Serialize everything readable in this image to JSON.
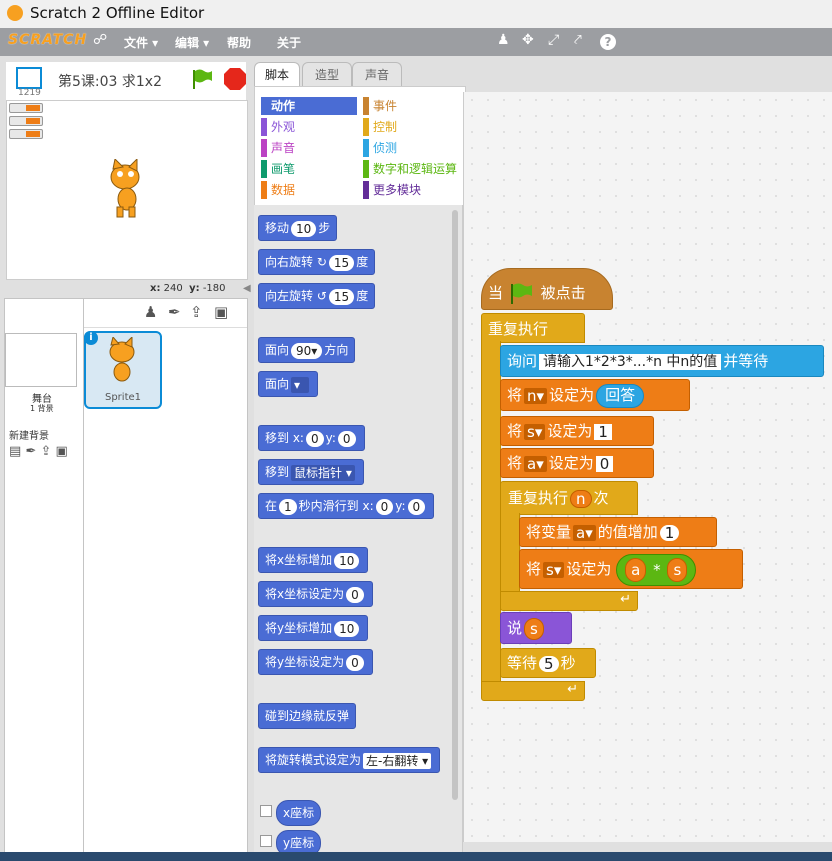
{
  "window": {
    "title": "Scratch 2 Offline Editor"
  },
  "menu": {
    "logo": "SCRATCH",
    "items": [
      "文件 ▾",
      "编辑 ▾",
      "帮助",
      "关于"
    ],
    "toolbar_icons": [
      "duplicate-icon",
      "delete-icon",
      "grow-icon",
      "shrink-icon",
      "help-icon"
    ]
  },
  "stage": {
    "project_title": "第5课:03 求1x2",
    "version": "1219",
    "mouse_x_label": "x:",
    "mouse_x": "240",
    "mouse_y_label": "y:",
    "mouse_y": "-180"
  },
  "sprites": {
    "stage_label": "舞台",
    "backdrops_count": "1 背景",
    "new_backdrop": "新建背景",
    "sprite1": "Sprite1",
    "info": "i"
  },
  "tabs": [
    "脚本",
    "造型",
    "声音"
  ],
  "categories": [
    {
      "label": "动作",
      "color": "#4a6cd4"
    },
    {
      "label": "外观",
      "color": "#8a55d7"
    },
    {
      "label": "声音",
      "color": "#bb42c3"
    },
    {
      "label": "画笔",
      "color": "#0e9a6c"
    },
    {
      "label": "数据",
      "color": "#ee7d16"
    },
    {
      "label": "事件",
      "color": "#c88330"
    },
    {
      "label": "控制",
      "color": "#e1a91a"
    },
    {
      "label": "侦测",
      "color": "#2ca5e2"
    },
    {
      "label": "数字和逻辑运算",
      "color": "#5cb712"
    },
    {
      "label": "更多模块",
      "color": "#632d99"
    }
  ],
  "palette": {
    "move": "移动",
    "move_steps": "10",
    "steps": "步",
    "turn_right": "向右旋转",
    "turn_right_deg": "15",
    "deg": "度",
    "turn_left": "向左旋转",
    "turn_left_deg": "15",
    "point_dir": "面向",
    "dir_val": "90▾",
    "dir_word": "方向",
    "point_towards": "面向",
    "goto_xy": "移到 x:",
    "goto_x": "0",
    "y_label": "y:",
    "goto_y": "0",
    "goto": "移到",
    "goto_target": "鼠标指针",
    "glide": "在",
    "glide_secs": "1",
    "glide_mid": "秒内滑行到 x:",
    "glide_x": "0",
    "glide_y": "0",
    "change_x": "将x坐标增加",
    "change_x_val": "10",
    "set_x": "将x坐标设定为",
    "set_x_val": "0",
    "change_y": "将y坐标增加",
    "change_y_val": "10",
    "set_y": "将y坐标设定为",
    "set_y_val": "0",
    "bounce": "碰到边缘就反弹",
    "rotation": "将旋转模式设定为",
    "rotation_val": "左-右翻转",
    "xpos": "x座标",
    "ypos": "y座标"
  },
  "script": {
    "when": "当",
    "clicked": "被点击",
    "forever": "重复执行",
    "ask": "询问",
    "ask_text": "请输入1*2*3*...*n  中n的值",
    "ask_wait": "并等待",
    "set": "将",
    "set_to": "设定为",
    "set_n_var": "n",
    "answer": "回答",
    "set_s_var": "s",
    "set_s_val": "1",
    "set_a_var": "a",
    "set_a_val": "0",
    "repeat": "重复执行",
    "repeat_n": "n",
    "times": "次",
    "change_var": "将变量",
    "change_a_var": "a",
    "change_by": "的值增加",
    "change_val": "1",
    "set_s2_var": "s",
    "op_a": "a",
    "op_mul": "*",
    "op_s": "s",
    "say": "说",
    "say_val": "s",
    "wait": "等待",
    "wait_val": "5",
    "secs": "秒"
  }
}
